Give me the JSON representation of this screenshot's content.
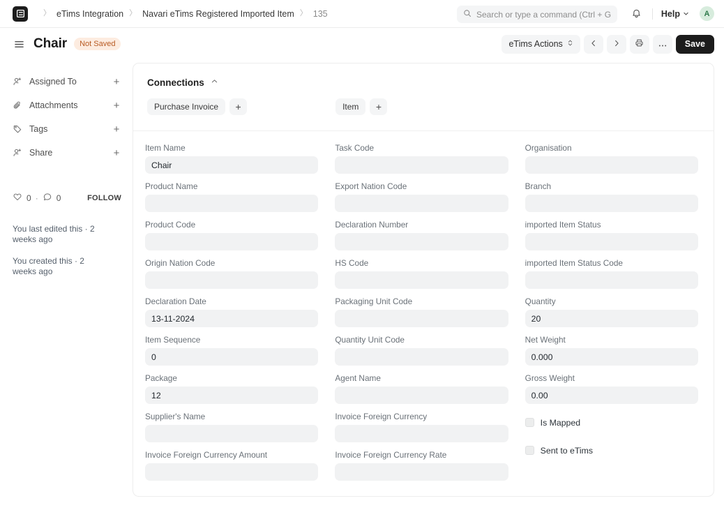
{
  "navbar": {
    "logo_icon": "frappe-logo-icon",
    "breadcrumbs": [
      {
        "label": "eTims Integration",
        "muted": false
      },
      {
        "label": "Navari eTims Registered Imported Item",
        "muted": false
      },
      {
        "label": "135",
        "muted": true
      }
    ],
    "search": {
      "placeholder": "Search or type a command (Ctrl + G)",
      "value": "",
      "icon": "search-icon"
    },
    "notifications_icon": "bell-icon",
    "help_label": "Help",
    "help_chevron_icon": "chevron-down-icon",
    "avatar_initial": "A",
    "avatar_bg": "#d7ecdd",
    "avatar_fg": "#2f7a4b"
  },
  "pagehead": {
    "menu_icon": "hamburger-menu-icon",
    "title": "Chair",
    "status_badge": "Not Saved",
    "status_badge_bg": "#fdece0",
    "status_badge_fg": "#b85a22",
    "actions_label": "eTims Actions",
    "actions_chevron_icon": "updown-chevron-icon",
    "prev_icon": "chevron-left-icon",
    "next_icon": "chevron-right-icon",
    "print_icon": "printer-icon",
    "more_icon": "ellipsis-icon",
    "save_label": "Save",
    "save_bg": "#1c1c1c"
  },
  "sidebar": {
    "items": [
      {
        "label": "Assigned To",
        "icon": "assign-user-icon",
        "action": "+"
      },
      {
        "label": "Attachments",
        "icon": "paperclip-icon",
        "action": "+"
      },
      {
        "label": "Tags",
        "icon": "tag-icon",
        "action": "+"
      },
      {
        "label": "Share",
        "icon": "share-user-icon",
        "action": "+"
      }
    ],
    "like_icon": "heart-icon",
    "like_count": "0",
    "dot": "·",
    "comment_icon": "comment-icon",
    "comment_count": "0",
    "follow_label": "FOLLOW",
    "edited_note": "You last edited this · 2 weeks ago",
    "created_note": "You created this · 2 weeks ago"
  },
  "connections": {
    "title": "Connections",
    "collapse_icon": "chevron-up-icon",
    "left": {
      "label": "Purchase Invoice",
      "add": "+"
    },
    "right": {
      "label": "Item",
      "add": "+"
    }
  },
  "form": {
    "col1": [
      {
        "label": "Item Name",
        "value": "Chair",
        "name": "item-name"
      },
      {
        "label": "Product Name",
        "value": "",
        "name": "product-name"
      },
      {
        "label": "Product Code",
        "value": "",
        "name": "product-code"
      },
      {
        "label": "Origin Nation Code",
        "value": "",
        "name": "origin-nation-code"
      },
      {
        "label": "Declaration Date",
        "value": "13-11-2024",
        "name": "declaration-date"
      },
      {
        "label": "Item Sequence",
        "value": "0",
        "name": "item-sequence"
      },
      {
        "label": "Package",
        "value": "12",
        "name": "package"
      },
      {
        "label": "Supplier's Name",
        "value": "",
        "name": "suppliers-name"
      },
      {
        "label": "Invoice Foreign Currency Amount",
        "value": "",
        "name": "invoice-foreign-currency-amount"
      }
    ],
    "col2": [
      {
        "label": "Task Code",
        "value": "",
        "name": "task-code"
      },
      {
        "label": "Export Nation Code",
        "value": "",
        "name": "export-nation-code"
      },
      {
        "label": "Declaration Number",
        "value": "",
        "name": "declaration-number"
      },
      {
        "label": "HS Code",
        "value": "",
        "name": "hs-code"
      },
      {
        "label": "Packaging Unit Code",
        "value": "",
        "name": "packaging-unit-code"
      },
      {
        "label": "Quantity Unit Code",
        "value": "",
        "name": "quantity-unit-code"
      },
      {
        "label": "Agent Name",
        "value": "",
        "name": "agent-name"
      },
      {
        "label": "Invoice Foreign Currency",
        "value": "",
        "name": "invoice-foreign-currency"
      },
      {
        "label": "Invoice Foreign Currency Rate",
        "value": "",
        "name": "invoice-foreign-currency-rate"
      }
    ],
    "col3": [
      {
        "label": "Organisation",
        "value": "",
        "name": "organisation"
      },
      {
        "label": "Branch",
        "value": "",
        "name": "branch"
      },
      {
        "label": "imported Item Status",
        "value": "",
        "name": "imported-item-status"
      },
      {
        "label": "imported Item Status Code",
        "value": "",
        "name": "imported-item-status-code"
      },
      {
        "label": "Quantity",
        "value": "20",
        "name": "quantity"
      },
      {
        "label": "Net Weight",
        "value": "0.000",
        "name": "net-weight"
      },
      {
        "label": "Gross Weight",
        "value": "0.00",
        "name": "gross-weight"
      }
    ],
    "checkboxes": [
      {
        "label": "Is Mapped",
        "checked": false,
        "name": "is-mapped"
      },
      {
        "label": "Sent to eTims",
        "checked": false,
        "name": "sent-to-etims"
      }
    ]
  }
}
